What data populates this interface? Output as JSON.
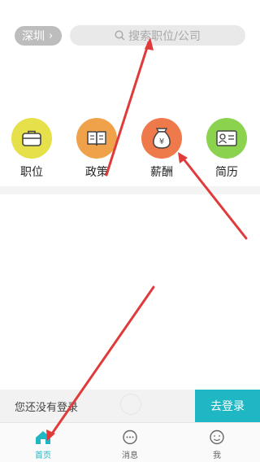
{
  "header": {
    "city": "深圳",
    "search_placeholder": "搜索职位/公司"
  },
  "menu": [
    {
      "label": "职位",
      "icon": "briefcase-icon",
      "color": "#e6e04a"
    },
    {
      "label": "政策",
      "icon": "book-icon",
      "color": "#f0a24a"
    },
    {
      "label": "薪酬",
      "icon": "money-bag-icon",
      "color": "#ee7a4c"
    },
    {
      "label": "简历",
      "icon": "id-card-icon",
      "color": "#8bd24e"
    }
  ],
  "login": {
    "message": "您还没有登录",
    "button": "去登录"
  },
  "tabs": [
    {
      "label": "首页",
      "icon": "home-icon",
      "active": true
    },
    {
      "label": "消息",
      "icon": "message-icon",
      "active": false
    },
    {
      "label": "我",
      "icon": "profile-icon",
      "active": false
    }
  ],
  "colors": {
    "accent": "#1fb7c4",
    "annotation_arrow": "#e03a3a"
  }
}
